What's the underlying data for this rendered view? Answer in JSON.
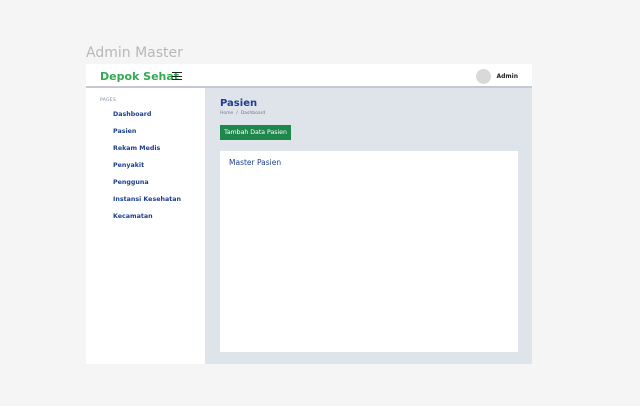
{
  "frame_label": "Admin Master",
  "topbar": {
    "brand": "Depok Sehat",
    "user_name": "Admin"
  },
  "sidebar": {
    "heading": "PAGES",
    "items": [
      {
        "label": "Dashboard"
      },
      {
        "label": "Pasien"
      },
      {
        "label": "Rekam Medis"
      },
      {
        "label": "Penyakit"
      },
      {
        "label": "Pengguna"
      },
      {
        "label": "Instansi Kesehatan"
      },
      {
        "label": "Kecamatan"
      }
    ]
  },
  "main": {
    "title": "Pasien",
    "breadcrumb": [
      "Home",
      "/",
      "Dashboard"
    ],
    "add_button_label": "Tambah Data Pasien",
    "card_title": "Master Pasien"
  },
  "colors": {
    "brand": "#34a853",
    "nav_text": "#1d3f8f",
    "button": "#1e874b",
    "main_background": "#dfe3ea"
  }
}
